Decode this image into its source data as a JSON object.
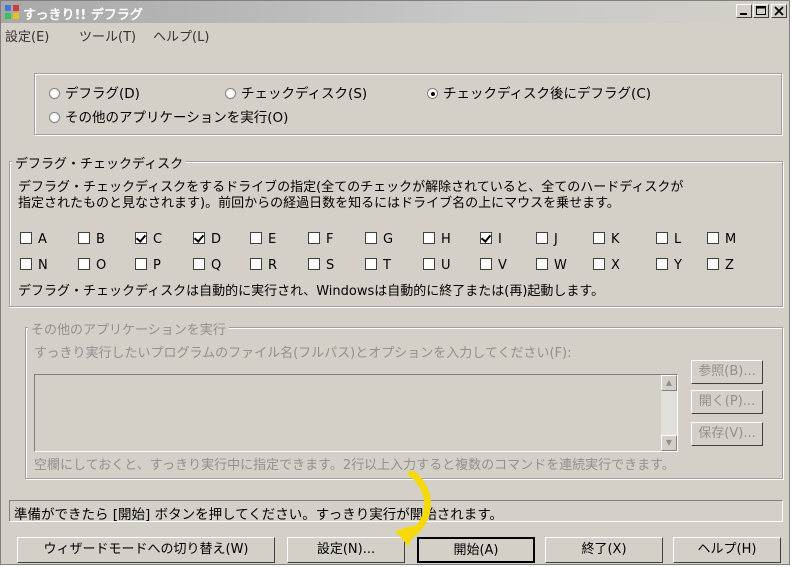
{
  "window": {
    "title": "すっきり!! デフラグ"
  },
  "menu": [
    "設定(E)",
    "ツール(T)",
    "ヘルプ(L)"
  ],
  "mode": {
    "options": [
      {
        "label": "デフラグ(D)",
        "selected": false
      },
      {
        "label": "チェックディスク(S)",
        "selected": false
      },
      {
        "label": "チェックディスク後にデフラグ(C)",
        "selected": true
      },
      {
        "label": "その他のアプリケーションを実行(O)",
        "selected": false
      }
    ]
  },
  "defrag_group": {
    "title": "デフラグ・チェックディスク",
    "desc_line1": "デフラグ・チェックディスクをするドライブの指定(全てのチェックが解除されていると、全てのハードディスクが",
    "desc_line2": "指定されたものと見なされます)。前回からの経過日数を知るにはドライブ名の上にマウスを乗せます。",
    "drives_row1": [
      {
        "label": "A",
        "checked": false
      },
      {
        "label": "B",
        "checked": false
      },
      {
        "label": "C",
        "checked": true
      },
      {
        "label": "D",
        "checked": true
      },
      {
        "label": "E",
        "checked": false
      },
      {
        "label": "F",
        "checked": false
      },
      {
        "label": "G",
        "checked": false
      },
      {
        "label": "H",
        "checked": false
      },
      {
        "label": "I",
        "checked": true
      },
      {
        "label": "J",
        "checked": false
      },
      {
        "label": "K",
        "checked": false
      },
      {
        "label": "L",
        "checked": false
      },
      {
        "label": "M",
        "checked": false
      }
    ],
    "drives_row2": [
      {
        "label": "N",
        "checked": false
      },
      {
        "label": "O",
        "checked": false
      },
      {
        "label": "P",
        "checked": false
      },
      {
        "label": "Q",
        "checked": false
      },
      {
        "label": "R",
        "checked": false
      },
      {
        "label": "S",
        "checked": false
      },
      {
        "label": "T",
        "checked": false
      },
      {
        "label": "U",
        "checked": false
      },
      {
        "label": "V",
        "checked": false
      },
      {
        "label": "W",
        "checked": false
      },
      {
        "label": "X",
        "checked": false
      },
      {
        "label": "Y",
        "checked": false
      },
      {
        "label": "Z",
        "checked": false
      }
    ],
    "note": "デフラグ・チェックディスクは自動的に実行され、Windowsは自動的に終了または(再)起動します。"
  },
  "app_group": {
    "title": "その他のアプリケーションを実行",
    "prompt": "すっきり実行したいプログラムのファイル名(フルパス)とオプションを入力してください(F):",
    "value": "",
    "browse_label": "参照(B)...",
    "open_label": "開く(P)...",
    "save_label": "保存(V)...",
    "hint": "空欄にしておくと、すっきり実行中に指定できます。2行以上入力すると複数のコマンドを連続実行できます。"
  },
  "status": "準備ができたら [開始] ボタンを押してください。すっきり実行が開始されます。",
  "buttons": {
    "wizard": "ウィザードモードへの切り替え(W)",
    "settings": "設定(N)...",
    "start": "開始(A)",
    "exit": "終了(X)",
    "help": "ヘルプ(H)"
  },
  "annotation": {
    "arrow_color": "#f5d90a"
  }
}
